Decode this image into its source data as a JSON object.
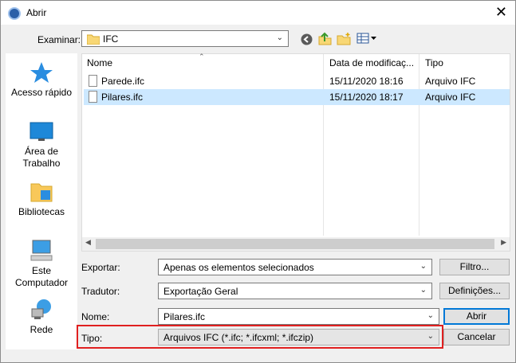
{
  "window": {
    "title": "Abrir",
    "close_glyph": "✕"
  },
  "toolbar": {
    "look_in_label": "Examinar:",
    "look_in_value": "IFC",
    "icons": [
      "back-icon",
      "up-folder-icon",
      "new-folder-icon",
      "view-menu-icon"
    ]
  },
  "places": [
    {
      "label": "Acesso rápido",
      "icon": "star-icon"
    },
    {
      "label": "Área de Trabalho",
      "icon": "desktop-icon"
    },
    {
      "label": "Bibliotecas",
      "icon": "libraries-icon"
    },
    {
      "label": "Este Computador",
      "icon": "computer-icon"
    },
    {
      "label": "Rede",
      "icon": "network-icon"
    }
  ],
  "filelist": {
    "columns": [
      "Nome",
      "Data de modificaç...",
      "Tipo"
    ],
    "rows": [
      {
        "name": "Parede.ifc",
        "date": "15/11/2020 18:16",
        "type": "Arquivo IFC",
        "selected": false
      },
      {
        "name": "Pilares.ifc",
        "date": "15/11/2020 18:17",
        "type": "Arquivo IFC",
        "selected": true
      }
    ]
  },
  "export": {
    "label": "Exportar:",
    "value": "Apenas os elementos selecionados",
    "button": "Filtro..."
  },
  "translator": {
    "label": "Tradutor:",
    "value": "Exportação Geral",
    "button": "Definições..."
  },
  "filename": {
    "label": "Nome:",
    "value": "Pilares.ifc",
    "open_button": "Abrir"
  },
  "filetype": {
    "label": "Tipo:",
    "value": "Arquivos IFC (*.ifc; *.ifcxml; *.ifczip)",
    "cancel_button": "Cancelar"
  },
  "colors": {
    "selection": "#cce8ff",
    "highlight": "#e02020",
    "accent": "#0078d7"
  }
}
